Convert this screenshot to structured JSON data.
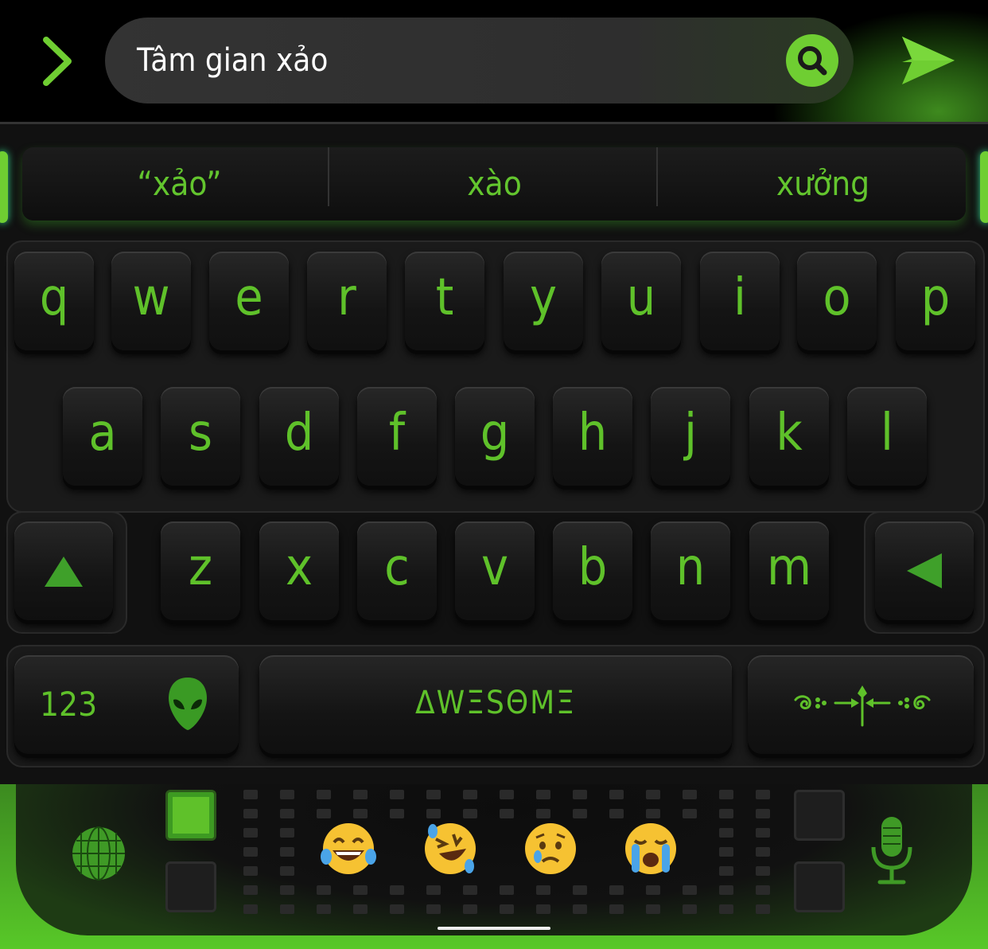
{
  "search": {
    "query": "Tâm gian xảo"
  },
  "suggestions": [
    "“xảo”",
    "xào",
    "xưởng"
  ],
  "keys": {
    "row1": [
      "q",
      "w",
      "e",
      "r",
      "t",
      "y",
      "u",
      "i",
      "o",
      "p"
    ],
    "row2": [
      "a",
      "s",
      "d",
      "f",
      "g",
      "h",
      "j",
      "k",
      "l"
    ],
    "row3": [
      "z",
      "x",
      "c",
      "v",
      "b",
      "n",
      "m"
    ]
  },
  "bottom_row": {
    "numbers_label": "123",
    "space_label": "ΔWΞSΘMΞ"
  },
  "icons": {
    "expand": "chevron-right-icon",
    "search": "search-icon",
    "send": "send-icon",
    "shift": "shift-icon",
    "backspace": "backspace-icon",
    "alien": "alien-icon",
    "return": "ornament-return-icon",
    "globe": "globe-icon",
    "microphone": "microphone-icon"
  },
  "emoji_bar": [
    "face-with-tears-of-joy",
    "rolling-on-floor-laughing",
    "crying-face",
    "loudly-crying-face"
  ],
  "colors": {
    "accent": "#5fc12a",
    "key_bg": "#141414"
  }
}
